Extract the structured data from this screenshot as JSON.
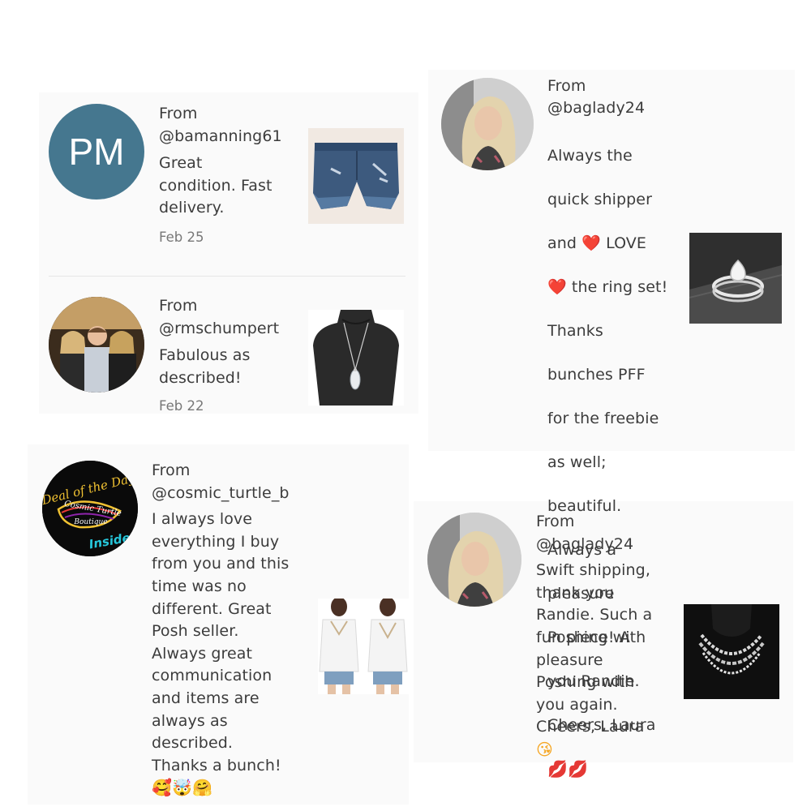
{
  "colors": {
    "panel_bg": "#fafafa",
    "text": "#3c3c3c",
    "date": "#777777",
    "pm_avatar": "#45778f",
    "heart": "#e02b2b"
  },
  "reviews": [
    {
      "from_label": "From",
      "handle": "@bamanning61",
      "avatar_initials": "PM",
      "comment": "Great\ncondition. Fast\ndelivery.",
      "date": "Feb 25",
      "product_icon": "denim-shorts-icon"
    },
    {
      "from_label": "From",
      "handle": "@rmschumpert",
      "comment": "Fabulous as\ndescribed!",
      "date": "Feb 22",
      "product_icon": "pendant-necklace-icon"
    },
    {
      "from_label": "From",
      "handle": "@baglady24",
      "comment_lines": [
        "Always the",
        "quick shipper",
        "and ❤️ LOVE",
        "❤️ the ring set!",
        "Thanks",
        "bunches PFF",
        "for the freebie",
        "as well;",
        "beautiful.",
        "Always a",
        "pleasure",
        "Poshing with",
        "you Randie.",
        "Cheers, Laura"
      ],
      "emojis": "💋💋",
      "product_icon": "ring-set-icon"
    },
    {
      "from_label": "From",
      "handle": "@cosmic_turtle_b",
      "avatar_text": {
        "line1": "Deal of the Day",
        "line2": "Cosmic Turtle",
        "line3": "Boutique",
        "line4": "Inside"
      },
      "comment": "I always love\neverything I buy\nfrom you and this\ntime was no\ndifferent. Great\nPosh seller.\nAlways great\ncommunication\nand items are\nalways as\ndescribed.\nThanks a bunch!",
      "emojis": "🥰🤯🤗",
      "product_icon": "white-blouse-icon"
    },
    {
      "from_label": "From",
      "handle": "@baglady24",
      "comment": "Swift shipping,\nthank you\nRandie. Such a\nfun piece! A\npleasure\nPoshing with\nyou again.\nCheers, Laura",
      "emojis": "😘",
      "product_icon": "chain-necklace-icon"
    }
  ]
}
